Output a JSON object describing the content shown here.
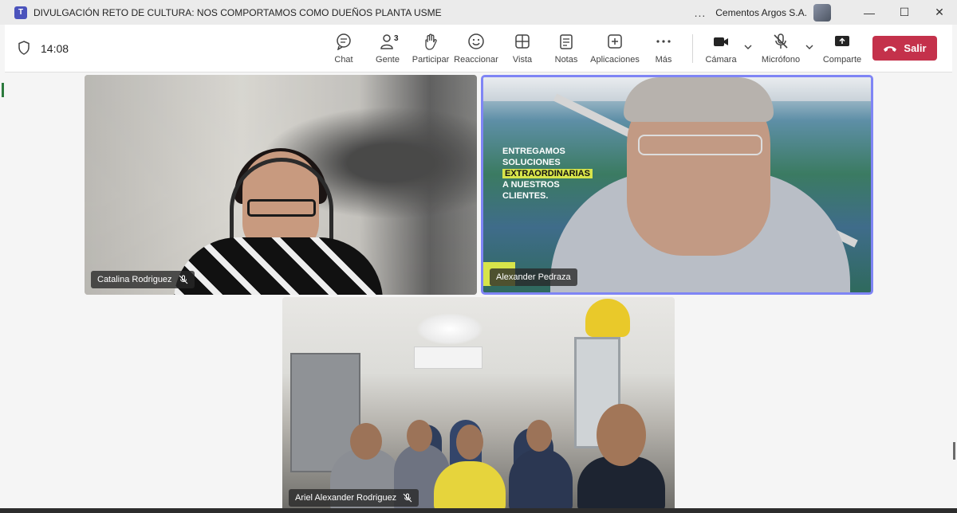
{
  "window": {
    "title": "DIVULGACIÓN RETO DE CULTURA: NOS COMPORTAMOS COMO DUEÑOS PLANTA USME",
    "more_label": "...",
    "organization": "Cementos Argos S.A.",
    "controls": {
      "minimize": "—",
      "maximize": "☐",
      "close": "✕"
    }
  },
  "meeting": {
    "elapsed": "14:08"
  },
  "toolbar": {
    "chat": "Chat",
    "people": "Gente",
    "people_count": "3",
    "raise": "Participar",
    "react": "Reaccionar",
    "view": "Vista",
    "notes": "Notas",
    "apps": "Aplicaciones",
    "more": "Más",
    "camera": "Cámara",
    "mic": "Micrófono",
    "share": "Comparte",
    "leave": "Salir"
  },
  "participants": [
    {
      "name": "Catalina Rodriguez",
      "muted": true
    },
    {
      "name": "Alexander Pedraza",
      "muted": false,
      "speaking": true
    },
    {
      "name": "Ariel Alexander Rodriguez",
      "muted": true
    }
  ],
  "background_banner": {
    "line1": "ENTREGAMOS",
    "line2": "SOLUCIONES",
    "line3": "EXTRAORDINARIAS",
    "line4": "A NUESTROS",
    "line5": "CLIENTES."
  },
  "colors": {
    "leave_button": "#c4314b",
    "active_speaker_border": "#7f85f5",
    "accent_yellow": "#d7e44a"
  }
}
